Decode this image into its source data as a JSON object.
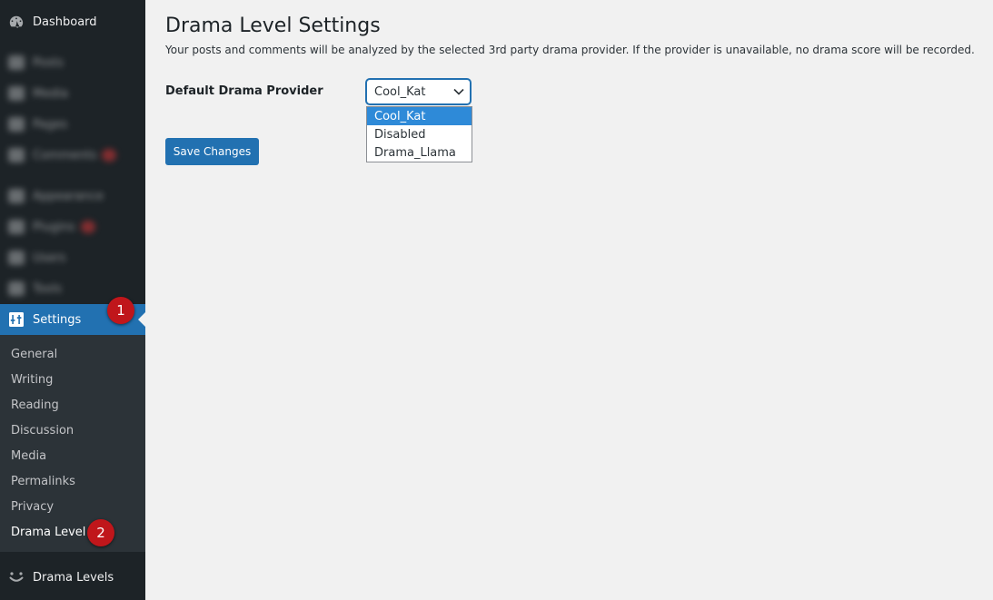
{
  "sidebar": {
    "dashboard_label": "Dashboard",
    "blurred_items": [
      "Posts",
      "Media",
      "Pages",
      "Comments",
      "Appearance",
      "Plugins",
      "Users",
      "Tools"
    ],
    "settings_label": "Settings",
    "submenu": [
      "General",
      "Writing",
      "Reading",
      "Discussion",
      "Media",
      "Permalinks",
      "Privacy",
      "Drama Level"
    ],
    "drama_levels_label": "Drama Levels"
  },
  "callouts": {
    "one": "1",
    "two": "2"
  },
  "main": {
    "title": "Drama Level Settings",
    "description": "Your posts and comments will be analyzed by the selected 3rd party drama provider. If the provider is unavailable, no drama score will be recorded.",
    "provider_label": "Default Drama Provider",
    "selected_provider": "Cool_Kat",
    "options": [
      "Cool_Kat",
      "Disabled",
      "Drama_Llama"
    ],
    "save_label": "Save Changes"
  },
  "colors": {
    "sidebar_bg": "#1d2327",
    "submenu_bg": "#2c3338",
    "accent": "#2271b1",
    "callout": "#c0161b"
  }
}
